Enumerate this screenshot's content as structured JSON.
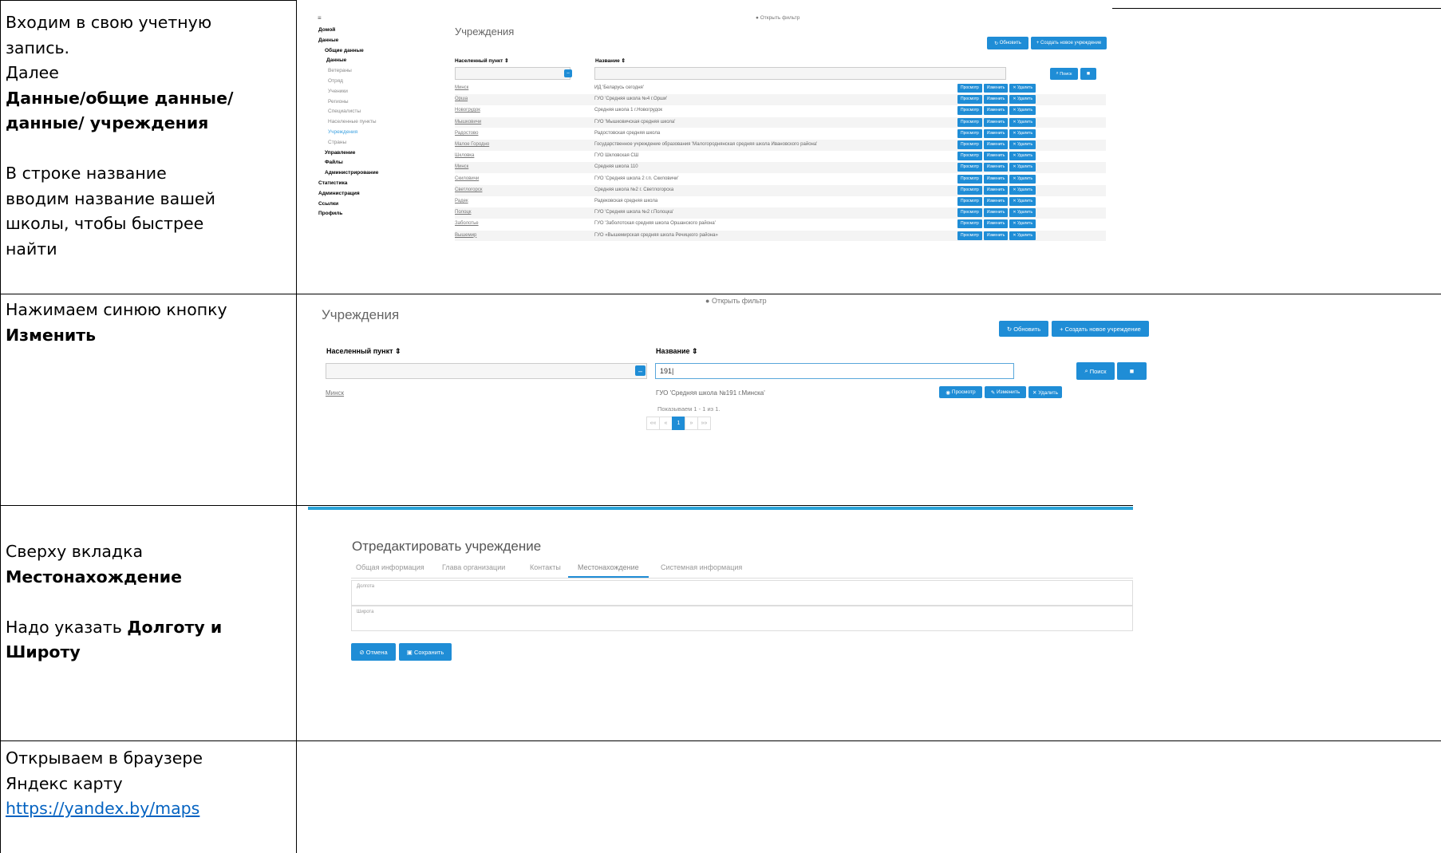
{
  "steps": [
    {
      "lines": [
        {
          "text": "Входим в свою учетную",
          "bold": false
        },
        {
          "text": "запись.",
          "bold": false
        },
        {
          "text": "Далее",
          "bold": false
        },
        {
          "text": "Данные/общие данные/",
          "bold": true
        },
        {
          "text": "данные/ учреждения",
          "bold": true
        },
        {
          "text": "",
          "bold": false
        },
        {
          "text": "В строке название",
          "bold": false
        },
        {
          "text": "вводим название вашей",
          "bold": false
        },
        {
          "text": "школы, чтобы быстрее",
          "bold": false
        },
        {
          "text": "найти",
          "bold": false
        }
      ]
    },
    {
      "lines": [
        {
          "text": "Нажимаем синюю кнопку",
          "bold": false
        },
        {
          "text": "Изменить",
          "bold": true
        }
      ]
    },
    {
      "lines": [
        {
          "text": "Сверху вкладка",
          "bold": false
        },
        {
          "text": "Местонахождение",
          "bold": true
        },
        {
          "text": "",
          "bold": false
        },
        {
          "segments": [
            {
              "text": "Надо указать ",
              "bold": false
            },
            {
              "text": "Долготу и",
              "bold": true
            }
          ]
        },
        {
          "text": "Широту",
          "bold": true
        }
      ]
    },
    {
      "lines": [
        {
          "text": "Открываем в браузере",
          "bold": false
        },
        {
          "text": "Яндекс карту",
          "bold": false
        },
        {
          "text": "https://yandex.by/maps",
          "link": true
        }
      ]
    }
  ],
  "shot1": {
    "menu_icon": "≡",
    "sidebar": [
      {
        "label": "Домой",
        "level": 0,
        "bold": true
      },
      {
        "label": "Данные",
        "level": 0,
        "bold": true
      },
      {
        "label": "Общие данные",
        "level": 1,
        "bold": true
      },
      {
        "label": "Данные",
        "level": 2,
        "bold": true
      },
      {
        "label": "Ветераны",
        "level": 3
      },
      {
        "label": "Отряд",
        "level": 3
      },
      {
        "label": "Ученики",
        "level": 3
      },
      {
        "label": "Регионы",
        "level": 3
      },
      {
        "label": "Специалисты",
        "level": 3
      },
      {
        "label": "Населенные пункты",
        "level": 3
      },
      {
        "label": "Учреждения",
        "level": 3,
        "active": true
      },
      {
        "label": "Страны",
        "level": 3
      },
      {
        "label": "Управление",
        "level": 1,
        "bold": true
      },
      {
        "label": "Файлы",
        "level": 1,
        "bold": true
      },
      {
        "label": "Администрирование",
        "level": 1,
        "bold": true
      },
      {
        "label": "Статистика",
        "level": 0,
        "bold": true
      },
      {
        "label": "Администрация",
        "level": 0,
        "bold": true
      },
      {
        "label": "Ссылки",
        "level": 0,
        "bold": true
      },
      {
        "label": "Профиль",
        "level": 0,
        "bold": true
      }
    ],
    "filter": "Открыть фильтр",
    "title": "Учреждения",
    "refresh": "Обновить",
    "create": "+ Создать новое учреждение",
    "col_city": "Населенный пункт ⇕",
    "col_name": "Название ⇕",
    "search": "Поиск",
    "actions": [
      "Просмотр",
      "Изменить",
      "✕ Удалить"
    ],
    "rows": [
      {
        "city": "Минск",
        "name": "ИД 'Беларусь сегодня'"
      },
      {
        "city": "Оршa",
        "name": "ГУО 'Средняя школа №4 г.Орши'"
      },
      {
        "city": "Новогрудок",
        "name": "Средняя школа 1 г.Новогрудок"
      },
      {
        "city": "Мышковичи",
        "name": "ГУО 'Мышковичская средняя школа'"
      },
      {
        "city": "Радостово",
        "name": "Радостовская средняя школа"
      },
      {
        "city": "Малое Городно",
        "name": "Государственное учреждение образования 'Малогороднянская средняя школа Ивановского района'"
      },
      {
        "city": "Шкловка",
        "name": "ГУО Шкловская СШ"
      },
      {
        "city": "Минск",
        "name": "Средняя школа 110"
      },
      {
        "city": "Скиловичи",
        "name": "ГУО 'Средняя школа 2 г.п. Скиловичи'"
      },
      {
        "city": "Светлогорск",
        "name": "Средняя школа №2 г. Светлогорска"
      },
      {
        "city": "Радек",
        "name": "Радековская средняя школа"
      },
      {
        "city": "Полоцк",
        "name": "ГУО 'Средняя школа №2 г.Полоцка'"
      },
      {
        "city": "Заболотье",
        "name": "ГУО 'Заболотская средняя школа Оршанского района'"
      },
      {
        "city": "Вышемир",
        "name": "ГУО «Вышемирская средняя школа Речицкого района»"
      }
    ]
  },
  "shot2": {
    "filter": "Открыть фильтр",
    "title": "Учреждения",
    "refresh": "Обновить",
    "create": "+ Создать новое учреждение",
    "col_city": "Населенный пункт ⇕",
    "col_name": "Название ⇕",
    "name_value": "191|",
    "search": "Поиск",
    "row_city": "Минск",
    "row_name": "ГУО 'Средняя школа №191 г.Минска'",
    "view": "Просмотр",
    "edit": "Изменить",
    "delete": "✕ Удалить",
    "shown": "Показываем 1 - 1 из 1.",
    "pages": [
      "««",
      "«",
      "1",
      "»",
      "»»"
    ]
  },
  "shot3": {
    "title": "Отредактировать учреждение",
    "tabs": [
      "Общая информация",
      "Глава организации",
      "Контакты",
      "Местонахождение",
      "Системная информация"
    ],
    "active_tab": 3,
    "longitude": "Долгота",
    "latitude": "Широта",
    "cancel": "Отмена",
    "save": "Сохранить"
  },
  "colors": {
    "accent": "#1f8dd6",
    "link": "#0563c1",
    "stripe": "#2aa3d8"
  }
}
